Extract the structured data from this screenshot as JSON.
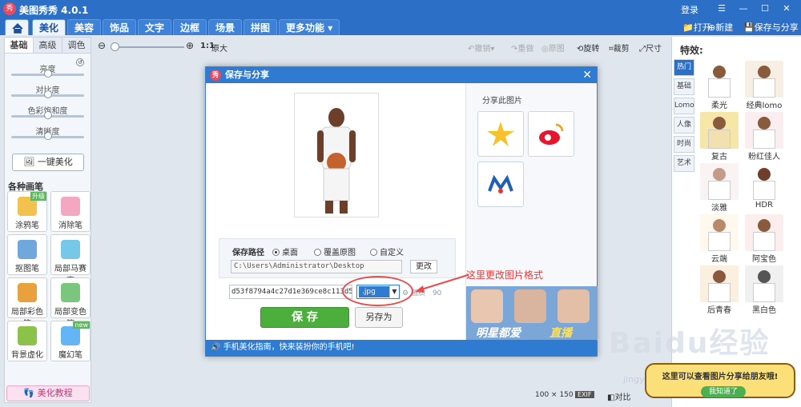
{
  "window": {
    "title": "美图秀秀 4.0.1",
    "logo_text": "秀",
    "login": "登录",
    "controls": [
      "☰",
      "—",
      "☐",
      "✕"
    ]
  },
  "menu": {
    "tabs": [
      "美化",
      "美容",
      "饰品",
      "文字",
      "边框",
      "场景",
      "拼图",
      "更多功能"
    ],
    "actions": {
      "open": "打开",
      "new": "新建",
      "save_share": "保存与分享"
    }
  },
  "left": {
    "tabs": [
      "基础",
      "高级",
      "调色"
    ],
    "sliders": [
      "亮度",
      "对比度",
      "色彩饱和度",
      "清晰度"
    ],
    "one_key": "一键美化",
    "brush_section": "各种画笔",
    "brushes": [
      "涂鸦笔",
      "消除笔",
      "抠图笔",
      "局部马赛克",
      "局部彩色笔",
      "局部变色笔",
      "背景虚化",
      "魔幻笔"
    ],
    "badge_upgrade": "升级",
    "badge_new": "new",
    "tutorial": "美化教程"
  },
  "toolbar": {
    "zoom_ratio": "1:1",
    "original_size": "原大",
    "undo": "撤销",
    "redo": "重做",
    "original_image": "原图",
    "rotate": "旋转",
    "crop": "裁剪",
    "size": "尺寸"
  },
  "right": {
    "title": "特效:",
    "categories": [
      "热门",
      "基础",
      "Lomo",
      "人像",
      "时尚",
      "艺术"
    ],
    "effects": [
      "柔光",
      "经典lomo",
      "复古",
      "粉红佳人",
      "淡雅",
      "HDR",
      "云端",
      "阿宝色",
      "后青春",
      "黑白色"
    ]
  },
  "dialog": {
    "title": "保存与分享",
    "close": "✕",
    "share_label": "分享此图片",
    "path_label": "保存路径",
    "options": [
      "桌面",
      "覆盖原图",
      "自定义"
    ],
    "path_value": "C:\\Users\\Administrator\\Desktop",
    "change_button": "更改",
    "filename": "d53f8794a4c27d1e369ce8c113d5a",
    "format": ".jpg",
    "quality_label": "画质",
    "quality_value": "90",
    "save_button": "保 存",
    "save_as_button": "另存为",
    "footer": "手机美化指南，快来装扮你的手机吧!",
    "banner_text": "明星都爱",
    "banner_text2": "直播"
  },
  "annotation": "这里更改图片格式",
  "status": {
    "dimensions": "100 × 150",
    "exif": "EXIF",
    "compare": "对比"
  },
  "tip": {
    "text": "这里可以查看图片分享给朋友哦!",
    "button": "我知道了"
  },
  "watermark": {
    "text": "Baidu经验",
    "url": "jingyan.baidu.com"
  }
}
